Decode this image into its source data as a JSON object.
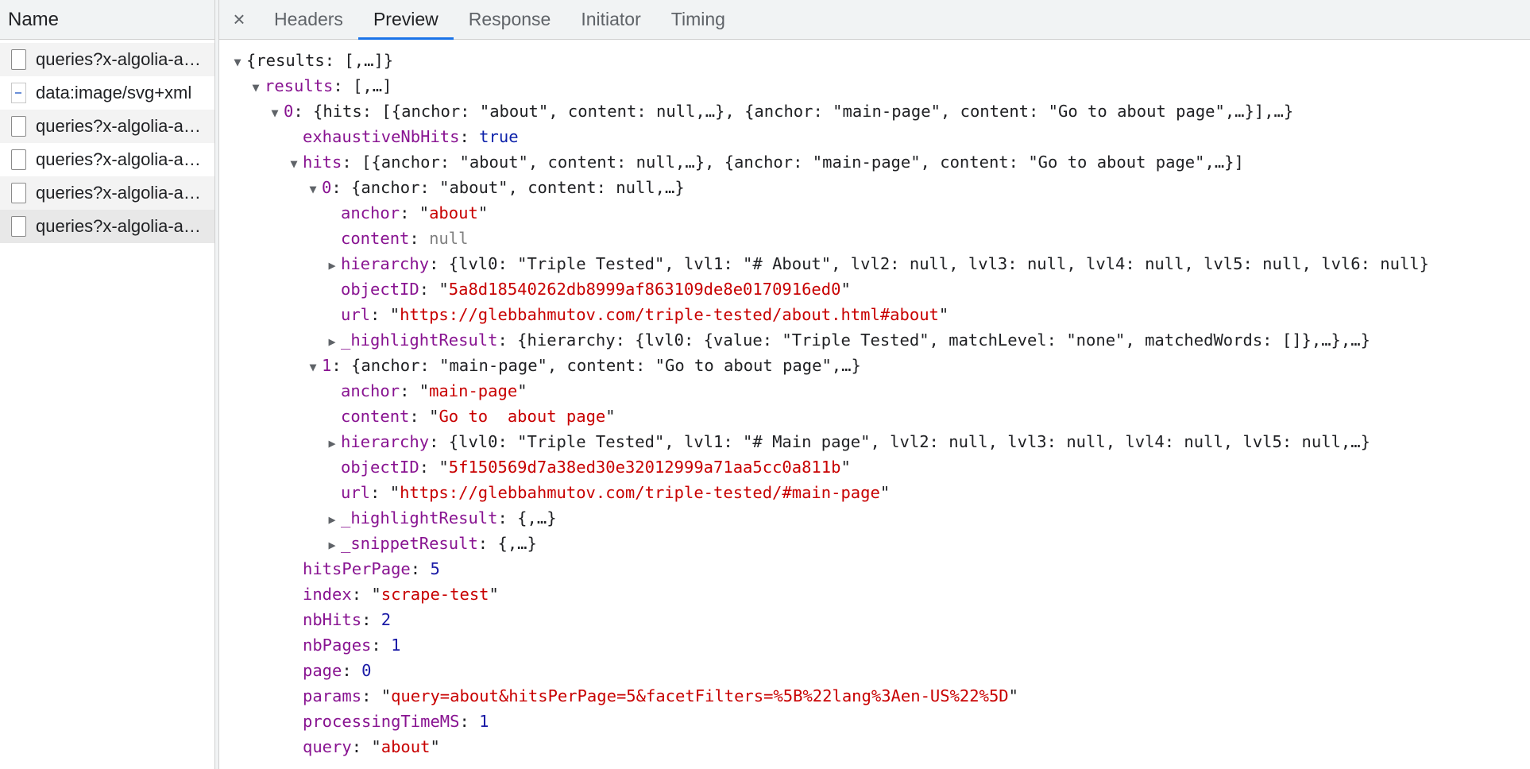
{
  "sidebar": {
    "header": "Name",
    "requests": [
      {
        "label": "queries?x-algolia-agent=Algolia",
        "icon": "file-icon"
      },
      {
        "label": "data:image/svg+xml",
        "icon": "svg-image-icon"
      },
      {
        "label": "queries?x-algolia-agent=Algolia",
        "icon": "file-icon"
      },
      {
        "label": "queries?x-algolia-agent=Algolia",
        "icon": "file-icon"
      },
      {
        "label": "queries?x-algolia-agent=Algolia",
        "icon": "file-icon"
      },
      {
        "label": "queries?x-algolia-agent=Algolia",
        "icon": "file-icon"
      }
    ]
  },
  "tabs": {
    "close": "×",
    "items": [
      "Headers",
      "Preview",
      "Response",
      "Initiator",
      "Timing"
    ],
    "active": "Preview"
  },
  "tree": {
    "root_summary": "{results: [,…]}",
    "results_key": "results",
    "results_summary": "[,…]",
    "r0_key": "0",
    "r0_summary": "{hits: [{anchor: \"about\", content: null,…}, {anchor: \"main-page\", content: \"Go to about page\",…}],…}",
    "exhaustive_key": "exhaustiveNbHits",
    "exhaustive_val": "true",
    "hits_key": "hits",
    "hits_summary": "[{anchor: \"about\", content: null,…}, {anchor: \"main-page\", content: \"Go to about page\",…}]",
    "h0_key": "0",
    "h0_summary": "{anchor: \"about\", content: null,…}",
    "h0_anchor_key": "anchor",
    "h0_anchor_val": "about",
    "h0_content_key": "content",
    "h0_content_val": "null",
    "h0_hier_key": "hierarchy",
    "h0_hier_summary": "{lvl0: \"Triple Tested\", lvl1: \"# About\", lvl2: null, lvl3: null, lvl4: null, lvl5: null, lvl6: null}",
    "h0_obj_key": "objectID",
    "h0_obj_val": "5a8d18540262db8999af863109de8e0170916ed0",
    "h0_url_key": "url",
    "h0_url_val": "https://glebbahmutov.com/triple-tested/about.html#about",
    "h0_hl_key": "_highlightResult",
    "h0_hl_summary": "{hierarchy: {lvl0: {value: \"Triple Tested\", matchLevel: \"none\", matchedWords: []},…},…}",
    "h1_key": "1",
    "h1_summary": "{anchor: \"main-page\", content: \"Go to about page\",…}",
    "h1_anchor_key": "anchor",
    "h1_anchor_val": "main-page",
    "h1_content_key": "content",
    "h1_content_val": "Go to  about page",
    "h1_hier_key": "hierarchy",
    "h1_hier_summary": "{lvl0: \"Triple Tested\", lvl1: \"# Main page\", lvl2: null, lvl3: null, lvl4: null, lvl5: null,…}",
    "h1_obj_key": "objectID",
    "h1_obj_val": "5f150569d7a38ed30e32012999a71aa5cc0a811b",
    "h1_url_key": "url",
    "h1_url_val": "https://glebbahmutov.com/triple-tested/#main-page",
    "h1_hl_key": "_highlightResult",
    "h1_hl_summary": "{,…}",
    "h1_sn_key": "_snippetResult",
    "h1_sn_summary": "{,…}",
    "hpp_key": "hitsPerPage",
    "hpp_val": "5",
    "index_key": "index",
    "index_val": "scrape-test",
    "nbhits_key": "nbHits",
    "nbhits_val": "2",
    "nbpages_key": "nbPages",
    "nbpages_val": "1",
    "page_key": "page",
    "page_val": "0",
    "params_key": "params",
    "params_val": "query=about&hitsPerPage=5&facetFilters=%5B%22lang%3Aen-US%22%5D",
    "ptime_key": "processingTimeMS",
    "ptime_val": "1",
    "query_key": "query",
    "query_val": "about"
  }
}
